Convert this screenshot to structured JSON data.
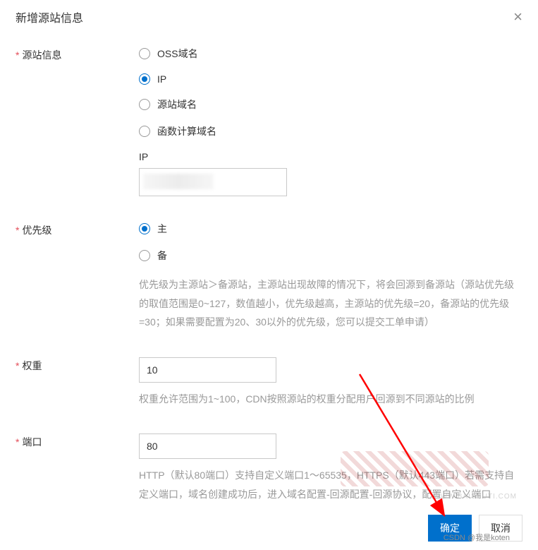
{
  "dialog": {
    "title": "新增源站信息"
  },
  "origin_info": {
    "label": "源站信息",
    "options": {
      "oss": "OSS域名",
      "ip": "IP",
      "origin_domain": "源站域名",
      "fc_domain": "函数计算域名"
    },
    "selected": "ip",
    "input_label": "IP",
    "input_value": ""
  },
  "priority": {
    "label": "优先级",
    "options": {
      "primary": "主",
      "backup": "备"
    },
    "selected": "primary",
    "help": "优先级为主源站＞备源站，主源站出现故障的情况下，将会回源到备源站（源站优先级的取值范围是0~127，数值越小，优先级越高，主源站的优先级=20，备源站的优先级=30；如果需要配置为20、30以外的优先级，您可以提交工单申请）"
  },
  "weight": {
    "label": "权重",
    "value": "10",
    "help": "权重允许范围为1~100，CDN按照源站的权重分配用户回源到不同源站的比例"
  },
  "port": {
    "label": "端口",
    "value": "80",
    "help": "HTTP（默认80端口）支持自定义端口1～65535，HTTPS（默认443端口）若需支持自定义端口，域名创建成功后，进入域名配置-回源配置-回源协议，配置自定义端口"
  },
  "footer": {
    "confirm": "确定",
    "cancel": "取消"
  },
  "watermarks": {
    "w1": "WWW.BAISHUTI.COM",
    "w2": "CSDN @我是koten"
  }
}
